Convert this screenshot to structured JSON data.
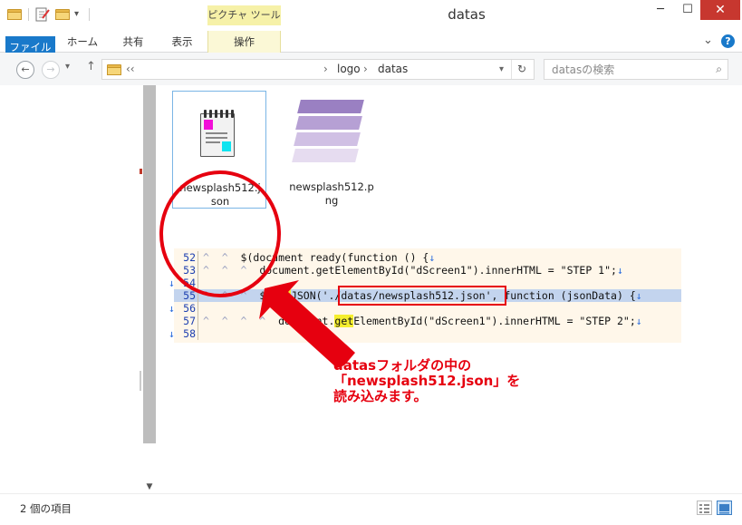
{
  "window": {
    "title": "datas",
    "contextual_tab_group": "ピクチャ ツール",
    "controls": {
      "minimize": "─",
      "maximize": "☐",
      "close": "✕"
    }
  },
  "ribbon": {
    "tabs": [
      {
        "label": "ファイル",
        "active": true
      },
      {
        "label": "ホーム"
      },
      {
        "label": "共有"
      },
      {
        "label": "表示"
      },
      {
        "label": "操作",
        "contextual": true
      }
    ],
    "collapse_icon": "chevron-down-icon",
    "help_icon": "help-icon",
    "help_label": "?"
  },
  "navigation": {
    "back": "←",
    "forward": "→",
    "recent": "▾",
    "up": "↑",
    "address": {
      "overflow": "‹‹",
      "separator": "›",
      "breadcrumb": [
        "logo",
        "datas"
      ],
      "dropdown": "▾",
      "refresh": "↻"
    },
    "search": {
      "placeholder": "datasの検索",
      "icon": "⌕"
    }
  },
  "files": [
    {
      "name": "newsplash512.json",
      "line1": "newsplash512.j",
      "line2": "son",
      "icon": "notepad-icon",
      "selected": true
    },
    {
      "name": "newsplash512.png",
      "line1": "newsplash512.p",
      "line2": "ng",
      "icon": "image-stack-icon",
      "selected": false
    }
  ],
  "code": {
    "lines": [
      {
        "num": "52",
        "parts": [
          [
            "tab",
            "^  ^  "
          ],
          [
            "t",
            "$(document"
          ],
          [
            "t",
            "ready(function () {"
          ],
          [
            "arrow",
            "↓"
          ]
        ]
      },
      {
        "num": "53",
        "parts": [
          [
            "tab",
            "^  ^  ^  "
          ],
          [
            "t",
            "document."
          ],
          [
            "t",
            "getElementById(\"dScreen1\").innerHTML = \"STEP 1\";"
          ],
          [
            "arrow",
            "↓"
          ]
        ]
      },
      {
        "num": "54",
        "parts": [
          [
            "arrow",
            "↓"
          ]
        ]
      },
      {
        "num": "55",
        "highlight": true,
        "parts": [
          [
            "tab",
            "^  ^  ^  "
          ],
          [
            "t",
            "$."
          ],
          [
            "ylw",
            "get"
          ],
          [
            "t",
            "JSON('./datas/newsplash512.json', function (jsonData) {"
          ],
          [
            "arrow",
            "↓"
          ]
        ]
      },
      {
        "num": "56",
        "parts": [
          [
            "arrow",
            "↓"
          ]
        ]
      },
      {
        "num": "57",
        "parts": [
          [
            "tab",
            "^  ^  ^  ^  "
          ],
          [
            "t",
            "document."
          ],
          [
            "ylw",
            "get"
          ],
          [
            "t",
            "ElementById(\"dScreen1\").innerHTML = \"STEP 2\";"
          ],
          [
            "arrow",
            "↓"
          ]
        ]
      },
      {
        "num": "58",
        "parts": [
          [
            "arrow",
            "↓"
          ]
        ]
      }
    ]
  },
  "annotation": {
    "text": "datasフォルダの中の\n「newsplash512.json」を\n読み込みます。"
  },
  "status": {
    "item_count": "2 個の項目",
    "view_details_icon": "details-view-icon",
    "view_large_icon": "large-icons-view-icon"
  },
  "colors": {
    "accent": "#1979ca",
    "annotation_red": "#e6000f",
    "highlight_line": "#c3d4ee",
    "code_bg": "#fff7ea"
  }
}
